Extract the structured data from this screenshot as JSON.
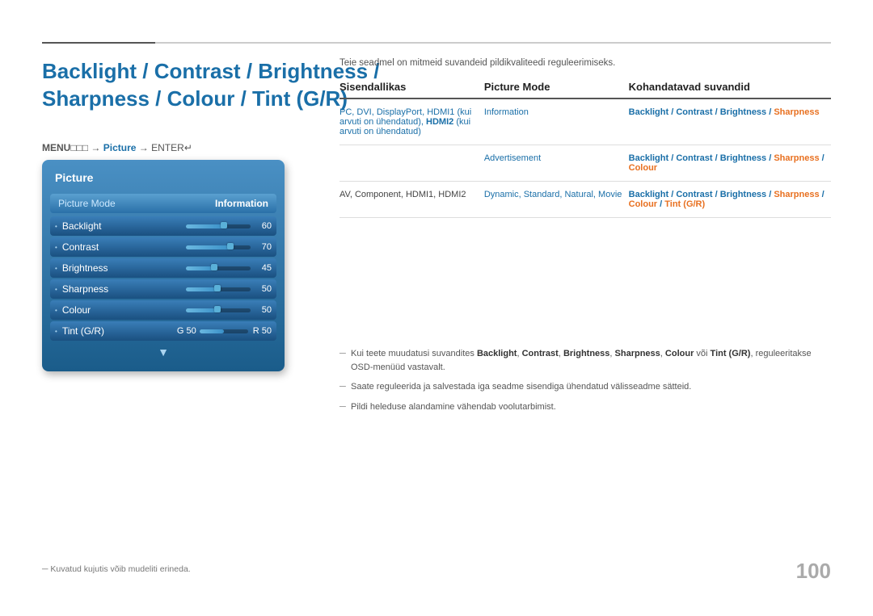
{
  "topLine": {},
  "title": {
    "line1": "Backlight / Contrast / Brightness /",
    "line2": "Sharpness / Colour / Tint (G/R)"
  },
  "menuNav": {
    "menu": "MENU",
    "arrow1": "→",
    "picture": "Picture",
    "arrow2": "→",
    "enter": "ENTER"
  },
  "panel": {
    "title": "Picture",
    "pictureMode": {
      "label": "Picture Mode",
      "value": "Information"
    },
    "settings": [
      {
        "name": "Backlight",
        "value": "60",
        "percent": 60
      },
      {
        "name": "Contrast",
        "value": "70",
        "percent": 70
      },
      {
        "name": "Brightness",
        "value": "45",
        "percent": 45
      },
      {
        "name": "Sharpness",
        "value": "50",
        "percent": 50
      },
      {
        "name": "Colour",
        "value": "50",
        "percent": 50
      }
    ],
    "tint": {
      "name": "Tint (G/R)",
      "gLabel": "G 50",
      "rLabel": "R 50",
      "percent": 50
    }
  },
  "rightContent": {
    "intro": "Teie seadmel on mitmeid suvandeid pildikvaliteedi reguleerimiseks.",
    "tableHeaders": [
      "Sisendallikas",
      "Picture Mode",
      "Kohandatavad suvandid"
    ],
    "tableRows": [
      {
        "source": "PC, DVI, DisplayPort, HDMI1 (kui arvuti on ühendatud), HDMI2 (kui arvuti on ühendatud)",
        "sourceHighlight": [
          "HDMI2"
        ],
        "mode": "Information",
        "available": "Backlight / Contrast / Brightness / Sharpness",
        "availableOrange": [
          "Sharpness"
        ]
      },
      {
        "source": "",
        "mode": "Advertisement",
        "available": "Backlight / Contrast / Brightness / Sharpness / Colour",
        "availableOrange": [
          "Sharpness",
          "Colour"
        ]
      },
      {
        "source": "AV, Component, HDMI1, HDMI2",
        "mode": "Dynamic, Standard, Natural, Movie",
        "available": "Backlight / Contrast / Brightness / Sharpness / Colour / Tint (G/R)",
        "availableOrange": [
          "Sharpness",
          "Colour",
          "Tint (G/R)"
        ]
      }
    ]
  },
  "notes": [
    "Kui teete muudatusi suvandites Backlight, Contrast, Brightness, Sharpness, Colour või Tint (G/R), reguleeritakse OSD-menüüd vastavalt.",
    "Saate reguleerida ja salvestada iga seadme sisendiga ühendatud välisseadme sätteid.",
    "Pildi heleduse alandamine vähendab voolutarbimist."
  ],
  "caption": "Kuvatud kujutis võib mudeliti erineda.",
  "pageNumber": "100"
}
